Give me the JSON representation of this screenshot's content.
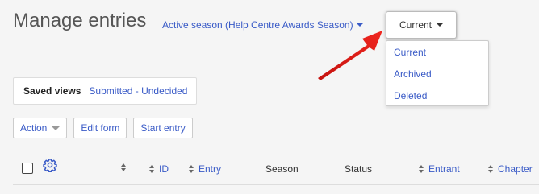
{
  "page": {
    "title": "Manage entries"
  },
  "season_filter": {
    "label": "Active season (Help Centre Awards Season)"
  },
  "status_filter": {
    "selected": "Current",
    "options": [
      "Current",
      "Archived",
      "Deleted"
    ]
  },
  "saved_views": {
    "label": "Saved views",
    "active_view": "Submitted - Undecided"
  },
  "toolbar": {
    "action_label": "Action",
    "edit_form_label": "Edit form",
    "start_entry_label": "Start entry"
  },
  "table": {
    "columns": [
      "ID",
      "Entry",
      "Season",
      "Status",
      "Entrant",
      "Chapter"
    ]
  },
  "colors": {
    "link": "#3a5bc7",
    "arrow": "#e8201b"
  },
  "icons": [
    "gear-icon",
    "sort-icon",
    "caret-down-icon",
    "arrow-pointer"
  ]
}
